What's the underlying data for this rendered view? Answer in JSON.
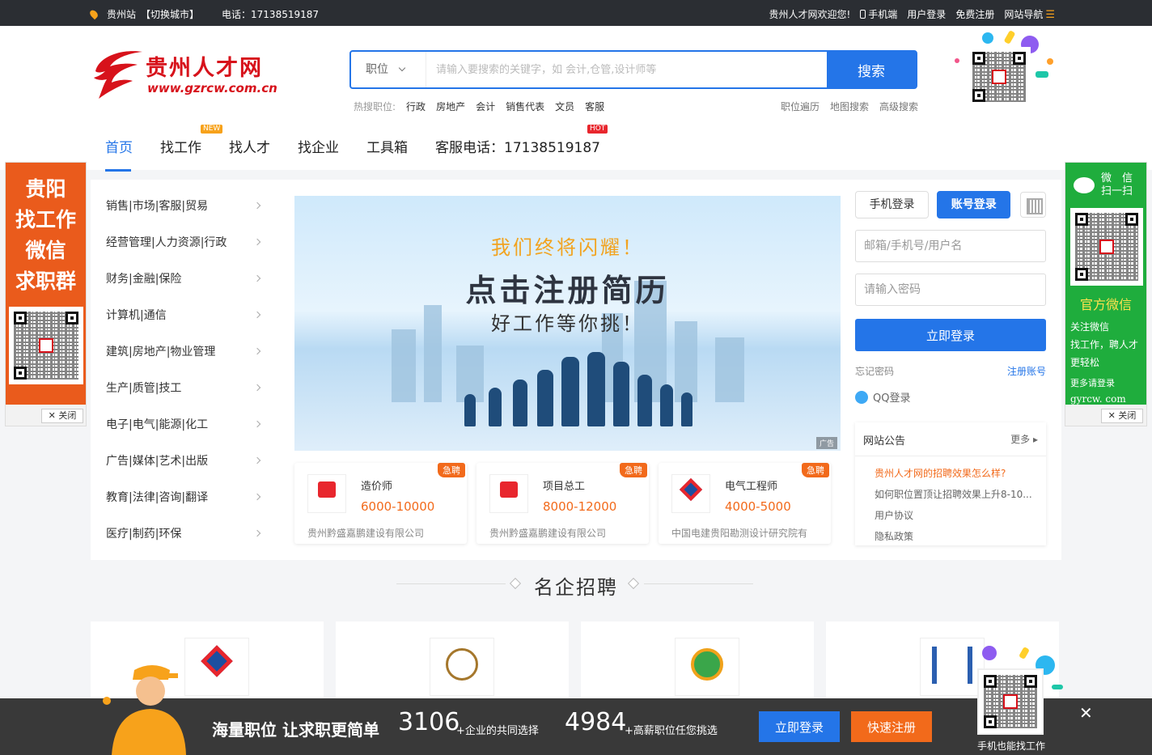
{
  "topbar": {
    "city": "贵州站",
    "switch_city": "【切换城市】",
    "phone": "电话：17138519187",
    "welcome": "贵州人才网欢迎您!",
    "mobile": "手机端",
    "user_login": "用户登录",
    "register": "免费注册",
    "site_nav": "网站导航"
  },
  "logo": {
    "cn": "贵州人才网",
    "url": "www.gzrcw.com.cn"
  },
  "search": {
    "type": "职位",
    "placeholder": "请输入要搜索的关键字，如 会计,仓管,设计师等",
    "button": "搜索",
    "hot_label": "热搜职位:",
    "hot": [
      "行政",
      "房地产",
      "会计",
      "销售代表",
      "文员",
      "客服"
    ],
    "links": [
      "职位遍历",
      "地图搜索",
      "高级搜索"
    ]
  },
  "nav": [
    {
      "label": "首页",
      "badge": ""
    },
    {
      "label": "找工作",
      "badge": "NEW"
    },
    {
      "label": "找人才",
      "badge": ""
    },
    {
      "label": "找企业",
      "badge": ""
    },
    {
      "label": "工具箱",
      "badge": ""
    },
    {
      "label": "客服电话：17138519187",
      "badge": "HOT"
    }
  ],
  "side_left": {
    "lines": [
      "贵阳",
      "找工作",
      "微信",
      "求职群"
    ],
    "close": "关闭"
  },
  "side_right": {
    "wechat": "微　信",
    "scan": "扫一扫",
    "official": "官方微信",
    "desc": [
      "关注微信",
      "找工作，聘人才",
      "更轻松"
    ],
    "more": "更多请登录",
    "domain": "gyrcw. com",
    "close": "关闭"
  },
  "categories": [
    "销售|市场|客服|贸易",
    "经营管理|人力资源|行政",
    "财务|金融|保险",
    "计算机|通信",
    "建筑|房地产|物业管理",
    "生产|质管|技工",
    "电子|电气|能源|化工",
    "广告|媒体|艺术|出版",
    "教育|法律|咨询|翻译",
    "医疗|制药|环保"
  ],
  "banner": {
    "line1": "我们终将闪耀！",
    "line2": "点击注册简历",
    "line3": "好工作等你挑！",
    "ad": "广告"
  },
  "jobs": [
    {
      "title": "造价师",
      "salary": "6000-10000",
      "company": "贵州黔盛嘉鹏建设有限公司",
      "tag": "急聘"
    },
    {
      "title": "项目总工",
      "salary": "8000-12000",
      "company": "贵州黔盛嘉鹏建设有限公司",
      "tag": "急聘"
    },
    {
      "title": "电气工程师",
      "salary": "4000-5000",
      "company": "中国电建贵阳勘测设计研究院有",
      "tag": "急聘"
    }
  ],
  "login": {
    "tab_phone": "手机登录",
    "tab_account": "账号登录",
    "user_placeholder": "邮箱/手机号/用户名",
    "pass_placeholder": "请输入密码",
    "submit": "立即登录",
    "forgot": "忘记密码",
    "register": "注册账号",
    "qq": "QQ登录"
  },
  "notice": {
    "title": "网站公告",
    "more": "更多",
    "items": [
      "贵州人才网的招聘效果怎么样?",
      "如何职位置顶让招聘效果上升8-10...",
      "用户协议",
      "隐私政策"
    ]
  },
  "section": {
    "title": "名企招聘"
  },
  "bottom": {
    "slogan": "海量职位 让求职更简单",
    "n1": "3106",
    "s1": "+企业的共同选择",
    "n2": "4984",
    "s2": "+高薪职位任您挑选",
    "login": "立即登录",
    "register": "快速注册",
    "qr_text": "手机也能找工作",
    "close": "✕"
  },
  "colors": {
    "primary": "#2475e8",
    "orange": "#f26a1b",
    "logo_red": "#d7121b",
    "wechat_green": "#1fad3d"
  }
}
